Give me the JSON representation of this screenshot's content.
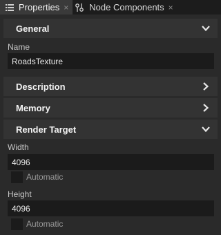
{
  "tabs": [
    {
      "label": "Properties",
      "icon": "properties-list-icon",
      "close": "×"
    },
    {
      "label": "Node Components",
      "icon": "node-components-icon",
      "close": "×"
    }
  ],
  "sections": {
    "general": {
      "title": "General",
      "expanded": true
    },
    "description": {
      "title": "Description",
      "expanded": false
    },
    "memory": {
      "title": "Memory",
      "expanded": false
    },
    "render_target": {
      "title": "Render Target",
      "expanded": true
    }
  },
  "fields": {
    "name": {
      "label": "Name",
      "value": "RoadsTexture"
    },
    "width": {
      "label": "Width",
      "value": "4096",
      "checkbox_label": "Automatic",
      "checked": false
    },
    "height": {
      "label": "Height",
      "value": "4096",
      "checkbox_label": "Automatic",
      "checked": false
    }
  }
}
